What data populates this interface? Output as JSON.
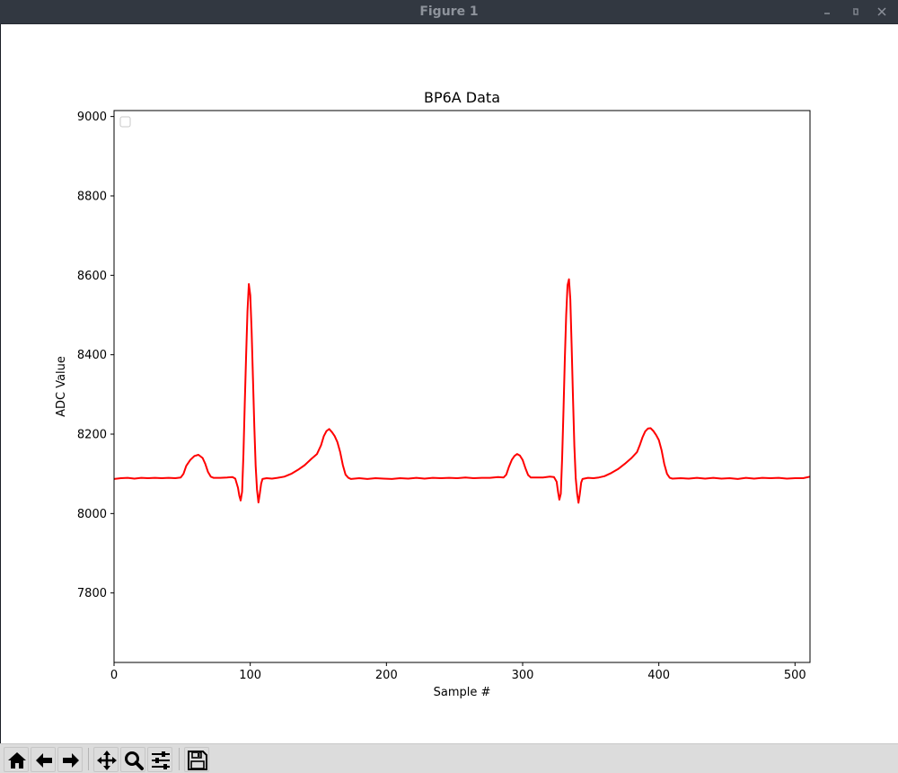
{
  "window": {
    "title": "Figure 1",
    "controls": [
      "minimize-icon",
      "restore-icon",
      "close-icon"
    ]
  },
  "toolbar": {
    "buttons": [
      {
        "name": "home-button",
        "icon": "home-icon"
      },
      {
        "name": "back-button",
        "icon": "arrow-left-icon"
      },
      {
        "name": "forward-button",
        "icon": "arrow-right-icon"
      },
      {
        "name": "pan-button",
        "icon": "move-icon"
      },
      {
        "name": "zoom-button",
        "icon": "magnifier-icon"
      },
      {
        "name": "configure-subplots-button",
        "icon": "sliders-icon"
      },
      {
        "name": "save-button",
        "icon": "floppy-disk-icon"
      }
    ]
  },
  "colors": {
    "series_line": "#ff0000",
    "titlebar": "#323841",
    "toolbar": "#dcdcdc"
  },
  "chart_data": {
    "type": "line",
    "title": "BP6A Data",
    "xlabel": "Sample #",
    "ylabel": "ADC Value",
    "xlim": [
      0,
      511
    ],
    "ylim": [
      7625,
      9015
    ],
    "xticks": [
      0,
      100,
      200,
      300,
      400,
      500
    ],
    "yticks": [
      7800,
      8000,
      8200,
      8400,
      8600,
      8800,
      9000
    ],
    "legend": "upper left (empty)",
    "grid": false,
    "series": [
      {
        "color": "#ff0000",
        "points": [
          [
            0,
            8087
          ],
          [
            5,
            8089
          ],
          [
            10,
            8090
          ],
          [
            15,
            8088
          ],
          [
            20,
            8090
          ],
          [
            25,
            8089
          ],
          [
            30,
            8090
          ],
          [
            35,
            8089
          ],
          [
            40,
            8090
          ],
          [
            45,
            8089
          ],
          [
            49,
            8091
          ],
          [
            51,
            8100
          ],
          [
            53,
            8120
          ],
          [
            56,
            8135
          ],
          [
            59,
            8145
          ],
          [
            62,
            8148
          ],
          [
            65,
            8140
          ],
          [
            67,
            8125
          ],
          [
            69,
            8105
          ],
          [
            71,
            8093
          ],
          [
            73,
            8090
          ],
          [
            78,
            8090
          ],
          [
            83,
            8091
          ],
          [
            87,
            8092
          ],
          [
            89,
            8088
          ],
          [
            91,
            8065
          ],
          [
            92,
            8045
          ],
          [
            93,
            8033
          ],
          [
            94,
            8055
          ],
          [
            95,
            8150
          ],
          [
            96,
            8280
          ],
          [
            97,
            8400
          ],
          [
            98,
            8510
          ],
          [
            99,
            8578
          ],
          [
            100,
            8550
          ],
          [
            101,
            8460
          ],
          [
            102,
            8340
          ],
          [
            103,
            8220
          ],
          [
            104,
            8120
          ],
          [
            105,
            8060
          ],
          [
            106,
            8028
          ],
          [
            107,
            8050
          ],
          [
            108,
            8075
          ],
          [
            109,
            8087
          ],
          [
            112,
            8089
          ],
          [
            116,
            8088
          ],
          [
            120,
            8090
          ],
          [
            125,
            8093
          ],
          [
            130,
            8100
          ],
          [
            135,
            8110
          ],
          [
            140,
            8122
          ],
          [
            145,
            8138
          ],
          [
            149,
            8150
          ],
          [
            152,
            8172
          ],
          [
            154,
            8195
          ],
          [
            156,
            8208
          ],
          [
            158,
            8213
          ],
          [
            160,
            8205
          ],
          [
            162,
            8195
          ],
          [
            164,
            8180
          ],
          [
            166,
            8155
          ],
          [
            168,
            8122
          ],
          [
            170,
            8098
          ],
          [
            172,
            8090
          ],
          [
            174,
            8087
          ],
          [
            180,
            8089
          ],
          [
            186,
            8087
          ],
          [
            192,
            8089
          ],
          [
            198,
            8088
          ],
          [
            204,
            8087
          ],
          [
            210,
            8089
          ],
          [
            216,
            8088
          ],
          [
            222,
            8090
          ],
          [
            228,
            8088
          ],
          [
            234,
            8090
          ],
          [
            240,
            8089
          ],
          [
            246,
            8090
          ],
          [
            252,
            8089
          ],
          [
            258,
            8091
          ],
          [
            264,
            8089
          ],
          [
            270,
            8090
          ],
          [
            276,
            8090
          ],
          [
            282,
            8092
          ],
          [
            286,
            8091
          ],
          [
            288,
            8098
          ],
          [
            290,
            8118
          ],
          [
            292,
            8135
          ],
          [
            294,
            8145
          ],
          [
            296,
            8150
          ],
          [
            298,
            8146
          ],
          [
            300,
            8135
          ],
          [
            302,
            8115
          ],
          [
            304,
            8097
          ],
          [
            306,
            8091
          ],
          [
            310,
            8091
          ],
          [
            315,
            8091
          ],
          [
            320,
            8093
          ],
          [
            323,
            8092
          ],
          [
            325,
            8080
          ],
          [
            326,
            8055
          ],
          [
            327,
            8035
          ],
          [
            328,
            8050
          ],
          [
            329,
            8140
          ],
          [
            330,
            8260
          ],
          [
            331,
            8390
          ],
          [
            332,
            8500
          ],
          [
            333,
            8575
          ],
          [
            334,
            8590
          ],
          [
            335,
            8540
          ],
          [
            336,
            8420
          ],
          [
            337,
            8290
          ],
          [
            338,
            8170
          ],
          [
            339,
            8090
          ],
          [
            340,
            8050
          ],
          [
            341,
            8027
          ],
          [
            342,
            8050
          ],
          [
            343,
            8078
          ],
          [
            344,
            8087
          ],
          [
            348,
            8090
          ],
          [
            352,
            8089
          ],
          [
            356,
            8091
          ],
          [
            360,
            8094
          ],
          [
            365,
            8102
          ],
          [
            370,
            8112
          ],
          [
            375,
            8125
          ],
          [
            380,
            8140
          ],
          [
            384,
            8155
          ],
          [
            386,
            8172
          ],
          [
            388,
            8192
          ],
          [
            390,
            8207
          ],
          [
            392,
            8214
          ],
          [
            394,
            8215
          ],
          [
            396,
            8208
          ],
          [
            398,
            8198
          ],
          [
            400,
            8185
          ],
          [
            402,
            8160
          ],
          [
            404,
            8125
          ],
          [
            406,
            8100
          ],
          [
            408,
            8090
          ],
          [
            410,
            8088
          ],
          [
            416,
            8089
          ],
          [
            422,
            8088
          ],
          [
            428,
            8090
          ],
          [
            434,
            8088
          ],
          [
            440,
            8090
          ],
          [
            446,
            8088
          ],
          [
            452,
            8089
          ],
          [
            458,
            8087
          ],
          [
            464,
            8090
          ],
          [
            470,
            8088
          ],
          [
            476,
            8090
          ],
          [
            482,
            8089
          ],
          [
            488,
            8090
          ],
          [
            494,
            8088
          ],
          [
            500,
            8089
          ],
          [
            506,
            8089
          ],
          [
            511,
            8093
          ]
        ]
      }
    ]
  }
}
